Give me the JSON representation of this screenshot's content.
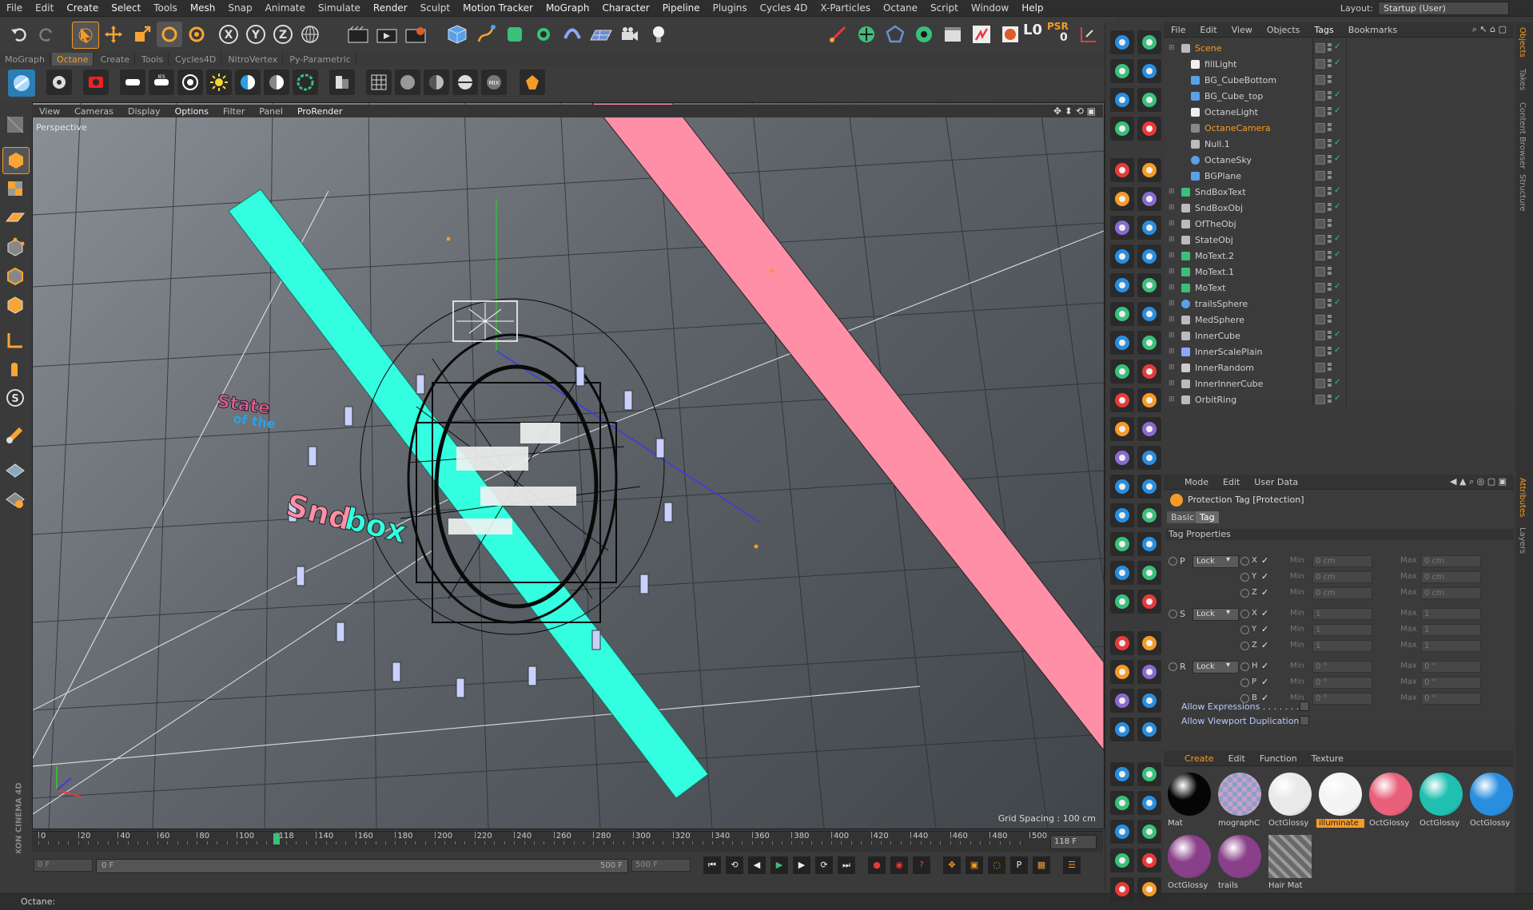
{
  "menubar": {
    "items": [
      "File",
      "Edit",
      "Create",
      "Select",
      "Tools",
      "Mesh",
      "Snap",
      "Animate",
      "Simulate",
      "Render",
      "Sculpt",
      "Motion Tracker",
      "MoGraph",
      "Character",
      "Pipeline",
      "Plugins",
      "Cycles 4D",
      "X-Particles",
      "Octane",
      "Script",
      "Window",
      "Help"
    ],
    "layout_label": "Layout:",
    "layout_value": "Startup (User)"
  },
  "top_toolbar": {
    "psr_label": "PSR",
    "psr_value": "0",
    "level_label": "L0"
  },
  "palette_tabs": [
    "MoGraph",
    "Octane",
    "Create",
    "Tools",
    "Cycles4D",
    "NitroVertex",
    "Py-Parametric"
  ],
  "palette_active": "Octane",
  "viewport": {
    "menu": [
      "View",
      "Cameras",
      "Display",
      "Options",
      "Filter",
      "Panel",
      "ProRender"
    ],
    "label": "Perspective",
    "grid_spacing": "Grid Spacing : 100 cm",
    "text_state": "State",
    "text_of_the": "of the",
    "text_sndbox_a": "Snd",
    "text_sndbox_b": "box"
  },
  "timeline": {
    "ticks": [
      "0",
      "20",
      "40",
      "60",
      "80",
      "100",
      "118",
      "140",
      "160",
      "180",
      "200",
      "220",
      "240",
      "260",
      "280",
      "300",
      "320",
      "340",
      "360",
      "380",
      "400",
      "420",
      "440",
      "460",
      "480",
      "500"
    ],
    "current_frame": "118 F",
    "start": "0 F",
    "range_start": "0 F",
    "range_end": "500 F",
    "end": "500 F"
  },
  "statusbar": {
    "text": "Octane:"
  },
  "object_manager": {
    "menu": [
      "File",
      "Edit",
      "View",
      "Objects",
      "Tags",
      "Bookmarks"
    ],
    "objects": [
      {
        "name": "Scene",
        "indent": 0,
        "icon": "null",
        "sel": true
      },
      {
        "name": "fillLight",
        "indent": 1,
        "icon": "light"
      },
      {
        "name": "BG_CubeBottom",
        "indent": 1,
        "icon": "cube"
      },
      {
        "name": "BG_Cube_top",
        "indent": 1,
        "icon": "cube"
      },
      {
        "name": "OctaneLight",
        "indent": 1,
        "icon": "light"
      },
      {
        "name": "OctaneCamera",
        "indent": 1,
        "icon": "camera",
        "sel": true
      },
      {
        "name": "Null.1",
        "indent": 1,
        "icon": "null"
      },
      {
        "name": "OctaneSky",
        "indent": 1,
        "icon": "sky"
      },
      {
        "name": "BGPlane",
        "indent": 1,
        "icon": "plane"
      },
      {
        "name": "SndBoxText",
        "indent": 0,
        "icon": "text"
      },
      {
        "name": "SndBoxObj",
        "indent": 0,
        "icon": "null"
      },
      {
        "name": "OfTheObj",
        "indent": 0,
        "icon": "null"
      },
      {
        "name": "StateObj",
        "indent": 0,
        "icon": "null"
      },
      {
        "name": "MoText.2",
        "indent": 0,
        "icon": "text"
      },
      {
        "name": "MoText.1",
        "indent": 0,
        "icon": "text"
      },
      {
        "name": "MoText",
        "indent": 0,
        "icon": "text"
      },
      {
        "name": "trailsSphere",
        "indent": 0,
        "icon": "sphere"
      },
      {
        "name": "MedSphere",
        "indent": 0,
        "icon": "null"
      },
      {
        "name": "InnerCube",
        "indent": 0,
        "icon": "null"
      },
      {
        "name": "InnerScalePlain",
        "indent": 0,
        "icon": "deformer"
      },
      {
        "name": "InnerRandom",
        "indent": 0,
        "icon": "effector"
      },
      {
        "name": "InnerInnerCube",
        "indent": 0,
        "icon": "null"
      },
      {
        "name": "OrbitRing",
        "indent": 0,
        "icon": "null"
      }
    ]
  },
  "attributes": {
    "menu": [
      "Mode",
      "Edit",
      "User Data"
    ],
    "title": "Protection Tag [Protection]",
    "tabs": [
      "Basic",
      "Tag"
    ],
    "section": "Tag Properties",
    "groups": [
      {
        "label": "P",
        "mode": "Lock",
        "rows": [
          {
            "axis": "X",
            "min": "0 cm",
            "max": "0 cm"
          },
          {
            "axis": "Y",
            "min": "0 cm",
            "max": "0 cm"
          },
          {
            "axis": "Z",
            "min": "0 cm",
            "max": "0 cm"
          }
        ]
      },
      {
        "label": "S",
        "mode": "Lock",
        "rows": [
          {
            "axis": "X",
            "min": "1",
            "max": "1"
          },
          {
            "axis": "Y",
            "min": "1",
            "max": "1"
          },
          {
            "axis": "Z",
            "min": "1",
            "max": "1"
          }
        ]
      },
      {
        "label": "R",
        "mode": "Lock",
        "rows": [
          {
            "axis": "H",
            "min": "0 °",
            "max": "0 °"
          },
          {
            "axis": "P",
            "min": "0 °",
            "max": "0 °"
          },
          {
            "axis": "B",
            "min": "0 °",
            "max": "0 °"
          }
        ]
      }
    ],
    "min_label": "Min",
    "max_label": "Max",
    "allow_expressions": "Allow Expressions . . . . . . .",
    "allow_duplication": "Allow Viewport Duplication"
  },
  "materials": {
    "menu": [
      "Create",
      "Edit",
      "Function",
      "Texture"
    ],
    "items": [
      {
        "name": "Mat",
        "color": "#050505"
      },
      {
        "name": "mographC",
        "color": "#8aa0c8"
      },
      {
        "name": "OctGlossy",
        "color": "#e9e9e9"
      },
      {
        "name": "illuminate",
        "color": "#f4f4f4",
        "highlight": true
      },
      {
        "name": "OctGlossy",
        "color": "#e8607a"
      },
      {
        "name": "OctGlossy",
        "color": "#20c0b0"
      },
      {
        "name": "OctGlossy",
        "color": "#2a8ee0"
      },
      {
        "name": "OctGlossy",
        "color": "#8a3f8a"
      },
      {
        "name": "trails",
        "color": "#8a3f8a"
      },
      {
        "name": "Hair Mat",
        "color": "#7a7a7a"
      }
    ]
  },
  "side_tabs": [
    "Objects",
    "Takes",
    "Content Browser",
    "Structure",
    "Attributes",
    "Layers"
  ],
  "colors": {
    "accent": "#f59b27",
    "cyan": "#33ffe0",
    "pink": "#ff8fa6",
    "bg": "#3a3a3a"
  }
}
